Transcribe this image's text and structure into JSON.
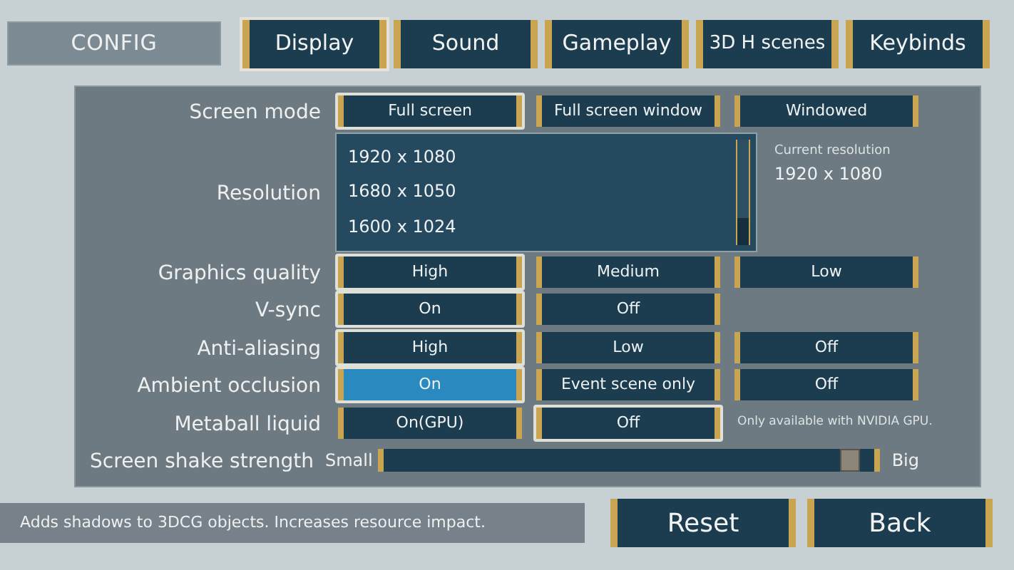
{
  "header": {
    "title": "CONFIG"
  },
  "tabs": [
    {
      "label": "Display",
      "selected": true
    },
    {
      "label": "Sound",
      "selected": false
    },
    {
      "label": "Gameplay",
      "selected": false
    },
    {
      "label": "3D H scenes",
      "selected": false
    },
    {
      "label": "Keybinds",
      "selected": false
    }
  ],
  "settings": [
    {
      "kind": "options",
      "label": "Screen mode",
      "options": [
        {
          "label": "Full screen",
          "selected": true,
          "highlighted": false
        },
        {
          "label": "Full screen window",
          "selected": false,
          "highlighted": false
        },
        {
          "label": "Windowed",
          "selected": false,
          "highlighted": false
        }
      ]
    },
    {
      "kind": "list",
      "label": "Resolution",
      "items": [
        "1920 x 1080",
        "1680 x 1050",
        "1600 x 1024"
      ],
      "current_label": "Current resolution",
      "current_value": "1920 x 1080"
    },
    {
      "kind": "options",
      "label": "Graphics quality",
      "options": [
        {
          "label": "High",
          "selected": true,
          "highlighted": false
        },
        {
          "label": "Medium",
          "selected": false,
          "highlighted": false
        },
        {
          "label": "Low",
          "selected": false,
          "highlighted": false
        }
      ]
    },
    {
      "kind": "options",
      "label": "V-sync",
      "options": [
        {
          "label": "On",
          "selected": true,
          "highlighted": false
        },
        {
          "label": "Off",
          "selected": false,
          "highlighted": false
        }
      ]
    },
    {
      "kind": "options",
      "label": "Anti-aliasing",
      "options": [
        {
          "label": "High",
          "selected": true,
          "highlighted": false
        },
        {
          "label": "Low",
          "selected": false,
          "highlighted": false
        },
        {
          "label": "Off",
          "selected": false,
          "highlighted": false
        }
      ]
    },
    {
      "kind": "options",
      "label": "Ambient occlusion",
      "options": [
        {
          "label": "On",
          "selected": true,
          "highlighted": true
        },
        {
          "label": "Event scene only",
          "selected": false,
          "highlighted": false
        },
        {
          "label": "Off",
          "selected": false,
          "highlighted": false
        }
      ]
    },
    {
      "kind": "options",
      "label": "Metaball liquid",
      "options": [
        {
          "label": "On(GPU)",
          "selected": false,
          "highlighted": false
        },
        {
          "label": "Off",
          "selected": true,
          "highlighted": false
        }
      ],
      "note": "Only available with NVIDIA GPU."
    },
    {
      "kind": "slider",
      "label": "Screen shake strength",
      "min_label": "Small",
      "max_label": "Big",
      "level": 0.97
    }
  ],
  "status_bar": {
    "text": "Adds shadows to 3DCG objects. Increases resource impact."
  },
  "buttons": [
    {
      "label": "Reset"
    },
    {
      "label": "Back"
    }
  ]
}
